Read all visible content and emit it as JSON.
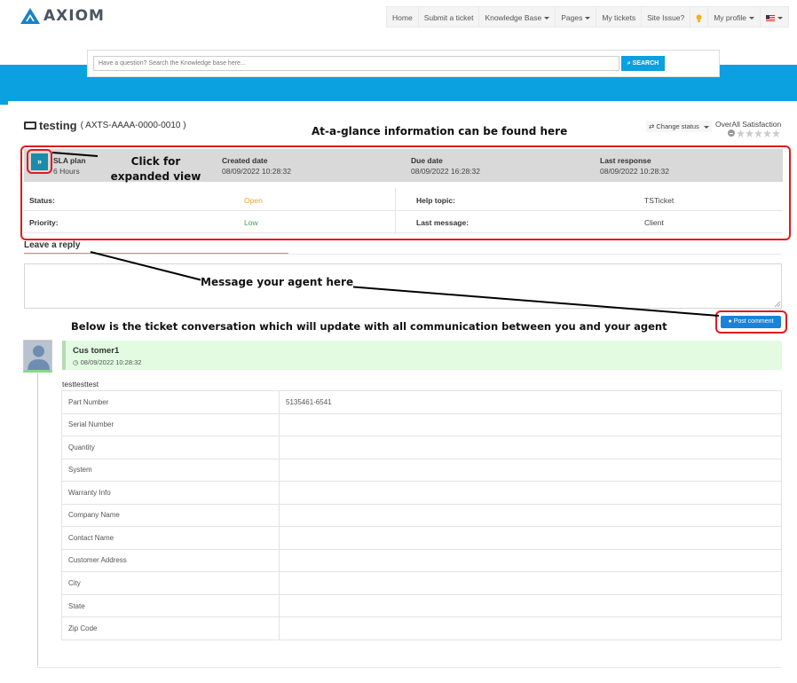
{
  "brand": {
    "name": "AXIOM",
    "accent": "#0ba0e0"
  },
  "nav": {
    "items": [
      {
        "label": "Home",
        "caret": false
      },
      {
        "label": "Submit a ticket",
        "caret": false
      },
      {
        "label": "Knowledge Base",
        "caret": true
      },
      {
        "label": "Pages",
        "caret": true
      },
      {
        "label": "My tickets",
        "caret": false
      },
      {
        "label": "Site Issue?",
        "caret": false
      },
      {
        "label": "",
        "caret": false,
        "icon": "lightbulb-icon"
      },
      {
        "label": "My profile",
        "caret": true
      },
      {
        "label": "",
        "caret": true,
        "icon": "us-flag-icon"
      }
    ]
  },
  "search": {
    "placeholder": "Have a question? Search the Knowledge base here...",
    "button": "SEARCH"
  },
  "ticket": {
    "title": "testing",
    "number": "( AXTS-AAAA-0000-0010 )",
    "change_status": "Change status",
    "satisfaction_label": "OverAll Satisfaction"
  },
  "info": {
    "sla_label": "SLA plan",
    "sla_value": "6 Hours",
    "created_label": "Created date",
    "created_value": "08/09/2022 10:28:32",
    "due_label": "Due date",
    "due_value": "08/09/2022 16:28:32",
    "last_response_label": "Last response",
    "last_response_value": "08/09/2022 10:28:32",
    "status_label": "Status:",
    "status_value": "Open",
    "priority_label": "Priority:",
    "priority_value": "Low",
    "help_topic_label": "Help topic:",
    "help_topic_value": "TSTicket",
    "last_message_label": "Last message:",
    "last_message_value": "Client"
  },
  "reply": {
    "title": "Leave a reply",
    "post_button": "Post comment"
  },
  "annotations": {
    "glance": "At-a-glance information can be found here",
    "expand": "Click for expanded view",
    "message": "Message your agent here",
    "conversation": "Below is the ticket conversation which will update with all communication between you and your agent"
  },
  "conversation": {
    "author": "Cus tomer1",
    "date": "08/09/2022 10:28:32",
    "body": "testtesttest",
    "fields": [
      {
        "label": "Part Number",
        "value": "5135461-6541"
      },
      {
        "label": "Serial Number",
        "value": ""
      },
      {
        "label": "Quantity",
        "value": ""
      },
      {
        "label": "System",
        "value": ""
      },
      {
        "label": "Warranty Info",
        "value": ""
      },
      {
        "label": "Company Name",
        "value": ""
      },
      {
        "label": "Contact Name",
        "value": ""
      },
      {
        "label": "Customer Address",
        "value": ""
      },
      {
        "label": "City",
        "value": ""
      },
      {
        "label": "State",
        "value": ""
      },
      {
        "label": "Zip Code",
        "value": ""
      }
    ]
  }
}
